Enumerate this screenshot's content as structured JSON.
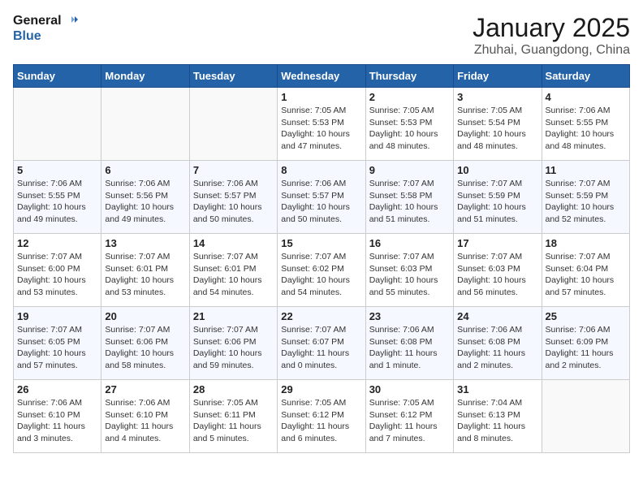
{
  "header": {
    "logo_line1": "General",
    "logo_line2": "Blue",
    "title": "January 2025",
    "subtitle": "Zhuhai, Guangdong, China"
  },
  "days_of_week": [
    "Sunday",
    "Monday",
    "Tuesday",
    "Wednesday",
    "Thursday",
    "Friday",
    "Saturday"
  ],
  "weeks": [
    [
      {
        "day": "",
        "sunrise": "",
        "sunset": "",
        "daylight": ""
      },
      {
        "day": "",
        "sunrise": "",
        "sunset": "",
        "daylight": ""
      },
      {
        "day": "",
        "sunrise": "",
        "sunset": "",
        "daylight": ""
      },
      {
        "day": "1",
        "sunrise": "Sunrise: 7:05 AM",
        "sunset": "Sunset: 5:53 PM",
        "daylight": "Daylight: 10 hours and 47 minutes."
      },
      {
        "day": "2",
        "sunrise": "Sunrise: 7:05 AM",
        "sunset": "Sunset: 5:53 PM",
        "daylight": "Daylight: 10 hours and 48 minutes."
      },
      {
        "day": "3",
        "sunrise": "Sunrise: 7:05 AM",
        "sunset": "Sunset: 5:54 PM",
        "daylight": "Daylight: 10 hours and 48 minutes."
      },
      {
        "day": "4",
        "sunrise": "Sunrise: 7:06 AM",
        "sunset": "Sunset: 5:55 PM",
        "daylight": "Daylight: 10 hours and 48 minutes."
      }
    ],
    [
      {
        "day": "5",
        "sunrise": "Sunrise: 7:06 AM",
        "sunset": "Sunset: 5:55 PM",
        "daylight": "Daylight: 10 hours and 49 minutes."
      },
      {
        "day": "6",
        "sunrise": "Sunrise: 7:06 AM",
        "sunset": "Sunset: 5:56 PM",
        "daylight": "Daylight: 10 hours and 49 minutes."
      },
      {
        "day": "7",
        "sunrise": "Sunrise: 7:06 AM",
        "sunset": "Sunset: 5:57 PM",
        "daylight": "Daylight: 10 hours and 50 minutes."
      },
      {
        "day": "8",
        "sunrise": "Sunrise: 7:06 AM",
        "sunset": "Sunset: 5:57 PM",
        "daylight": "Daylight: 10 hours and 50 minutes."
      },
      {
        "day": "9",
        "sunrise": "Sunrise: 7:07 AM",
        "sunset": "Sunset: 5:58 PM",
        "daylight": "Daylight: 10 hours and 51 minutes."
      },
      {
        "day": "10",
        "sunrise": "Sunrise: 7:07 AM",
        "sunset": "Sunset: 5:59 PM",
        "daylight": "Daylight: 10 hours and 51 minutes."
      },
      {
        "day": "11",
        "sunrise": "Sunrise: 7:07 AM",
        "sunset": "Sunset: 5:59 PM",
        "daylight": "Daylight: 10 hours and 52 minutes."
      }
    ],
    [
      {
        "day": "12",
        "sunrise": "Sunrise: 7:07 AM",
        "sunset": "Sunset: 6:00 PM",
        "daylight": "Daylight: 10 hours and 53 minutes."
      },
      {
        "day": "13",
        "sunrise": "Sunrise: 7:07 AM",
        "sunset": "Sunset: 6:01 PM",
        "daylight": "Daylight: 10 hours and 53 minutes."
      },
      {
        "day": "14",
        "sunrise": "Sunrise: 7:07 AM",
        "sunset": "Sunset: 6:01 PM",
        "daylight": "Daylight: 10 hours and 54 minutes."
      },
      {
        "day": "15",
        "sunrise": "Sunrise: 7:07 AM",
        "sunset": "Sunset: 6:02 PM",
        "daylight": "Daylight: 10 hours and 54 minutes."
      },
      {
        "day": "16",
        "sunrise": "Sunrise: 7:07 AM",
        "sunset": "Sunset: 6:03 PM",
        "daylight": "Daylight: 10 hours and 55 minutes."
      },
      {
        "day": "17",
        "sunrise": "Sunrise: 7:07 AM",
        "sunset": "Sunset: 6:03 PM",
        "daylight": "Daylight: 10 hours and 56 minutes."
      },
      {
        "day": "18",
        "sunrise": "Sunrise: 7:07 AM",
        "sunset": "Sunset: 6:04 PM",
        "daylight": "Daylight: 10 hours and 57 minutes."
      }
    ],
    [
      {
        "day": "19",
        "sunrise": "Sunrise: 7:07 AM",
        "sunset": "Sunset: 6:05 PM",
        "daylight": "Daylight: 10 hours and 57 minutes."
      },
      {
        "day": "20",
        "sunrise": "Sunrise: 7:07 AM",
        "sunset": "Sunset: 6:06 PM",
        "daylight": "Daylight: 10 hours and 58 minutes."
      },
      {
        "day": "21",
        "sunrise": "Sunrise: 7:07 AM",
        "sunset": "Sunset: 6:06 PM",
        "daylight": "Daylight: 10 hours and 59 minutes."
      },
      {
        "day": "22",
        "sunrise": "Sunrise: 7:07 AM",
        "sunset": "Sunset: 6:07 PM",
        "daylight": "Daylight: 11 hours and 0 minutes."
      },
      {
        "day": "23",
        "sunrise": "Sunrise: 7:06 AM",
        "sunset": "Sunset: 6:08 PM",
        "daylight": "Daylight: 11 hours and 1 minute."
      },
      {
        "day": "24",
        "sunrise": "Sunrise: 7:06 AM",
        "sunset": "Sunset: 6:08 PM",
        "daylight": "Daylight: 11 hours and 2 minutes."
      },
      {
        "day": "25",
        "sunrise": "Sunrise: 7:06 AM",
        "sunset": "Sunset: 6:09 PM",
        "daylight": "Daylight: 11 hours and 2 minutes."
      }
    ],
    [
      {
        "day": "26",
        "sunrise": "Sunrise: 7:06 AM",
        "sunset": "Sunset: 6:10 PM",
        "daylight": "Daylight: 11 hours and 3 minutes."
      },
      {
        "day": "27",
        "sunrise": "Sunrise: 7:06 AM",
        "sunset": "Sunset: 6:10 PM",
        "daylight": "Daylight: 11 hours and 4 minutes."
      },
      {
        "day": "28",
        "sunrise": "Sunrise: 7:05 AM",
        "sunset": "Sunset: 6:11 PM",
        "daylight": "Daylight: 11 hours and 5 minutes."
      },
      {
        "day": "29",
        "sunrise": "Sunrise: 7:05 AM",
        "sunset": "Sunset: 6:12 PM",
        "daylight": "Daylight: 11 hours and 6 minutes."
      },
      {
        "day": "30",
        "sunrise": "Sunrise: 7:05 AM",
        "sunset": "Sunset: 6:12 PM",
        "daylight": "Daylight: 11 hours and 7 minutes."
      },
      {
        "day": "31",
        "sunrise": "Sunrise: 7:04 AM",
        "sunset": "Sunset: 6:13 PM",
        "daylight": "Daylight: 11 hours and 8 minutes."
      },
      {
        "day": "",
        "sunrise": "",
        "sunset": "",
        "daylight": ""
      }
    ]
  ]
}
